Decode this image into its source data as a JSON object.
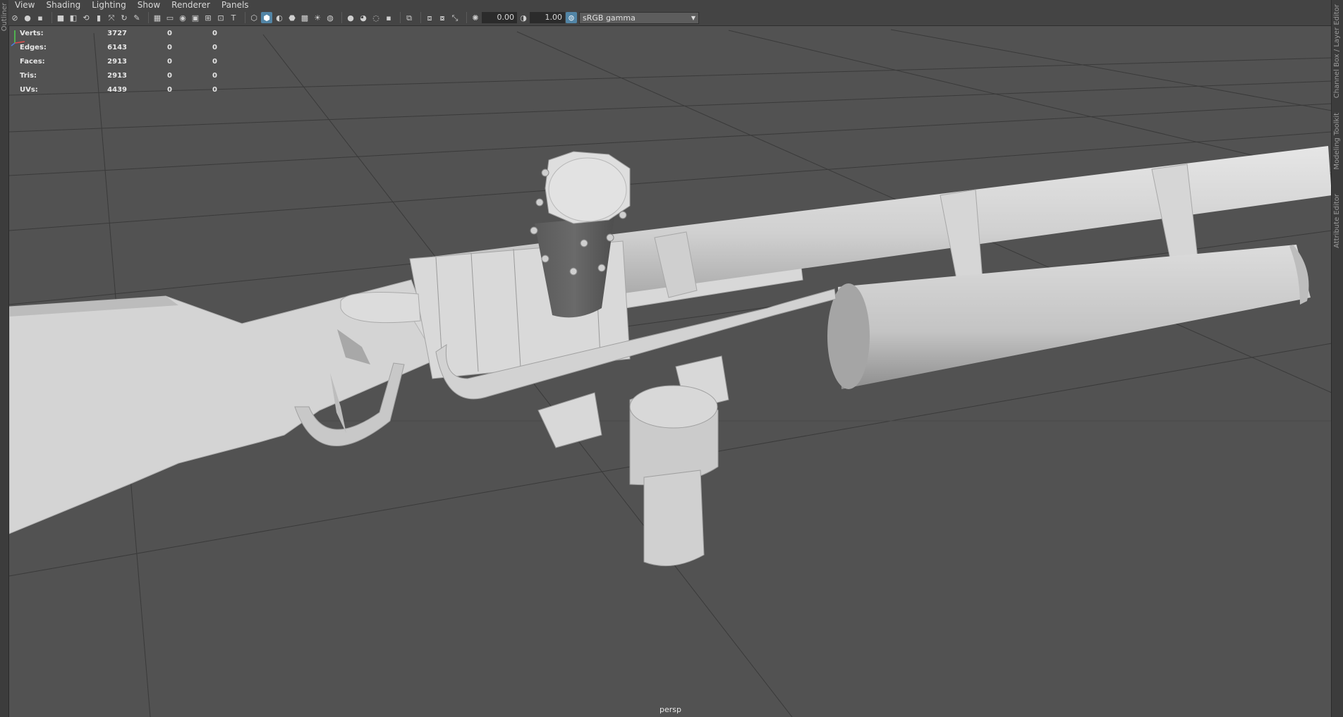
{
  "left_panel_label": "Outliner",
  "menu": [
    "View",
    "Shading",
    "Lighting",
    "Show",
    "Renderer",
    "Panels"
  ],
  "toolbar": {
    "icons": [
      "select-camera-icon",
      "lock-camera-icon",
      "camera-attributes-icon",
      "bookmark-icon",
      "image-plane-icon",
      "2d-pan-zoom-icon",
      "grease-pencil-icon",
      "grid-icon",
      "film-gate-icon",
      "resolution-gate-icon",
      "gate-mask-icon",
      "field-chart-icon",
      "safe-action-icon",
      "safe-title-icon",
      "wireframe-icon",
      "smooth-shade-all-icon",
      "default-material-icon",
      "wireframe-on-shaded-icon",
      "xray-icon",
      "use-all-lights-icon",
      "shadows-icon",
      "screen-space-ao-icon",
      "motion-blur-icon",
      "anti-aliasing-icon",
      "depth-of-field-icon",
      "isolate-select-icon",
      "xray-joints-icon",
      "xray-active-components-icon",
      "exposure-icon",
      "gamma-icon",
      "color-management-icon"
    ],
    "exposure_value": "0.00",
    "gamma_value": "1.00",
    "view_transform": "sRGB gamma"
  },
  "hud": [
    {
      "label": "Verts:",
      "values": [
        "3727",
        "0",
        "0"
      ]
    },
    {
      "label": "Edges:",
      "values": [
        "6143",
        "0",
        "0"
      ]
    },
    {
      "label": "Faces:",
      "values": [
        "2913",
        "0",
        "0"
      ]
    },
    {
      "label": "Tris:",
      "values": [
        "2913",
        "0",
        "0"
      ]
    },
    {
      "label": "UVs:",
      "values": [
        "4439",
        "0",
        "0"
      ]
    }
  ],
  "camera_label": "persp",
  "right_panel_labels": [
    "Channel Box / Layer Editor",
    "Modeling Toolkit",
    "Attribute Editor"
  ],
  "colors": {
    "viewport_bg": "#525252",
    "model": "#d2d2d2",
    "grid": "#3a3a3a",
    "active_icon": "#5285a6"
  }
}
